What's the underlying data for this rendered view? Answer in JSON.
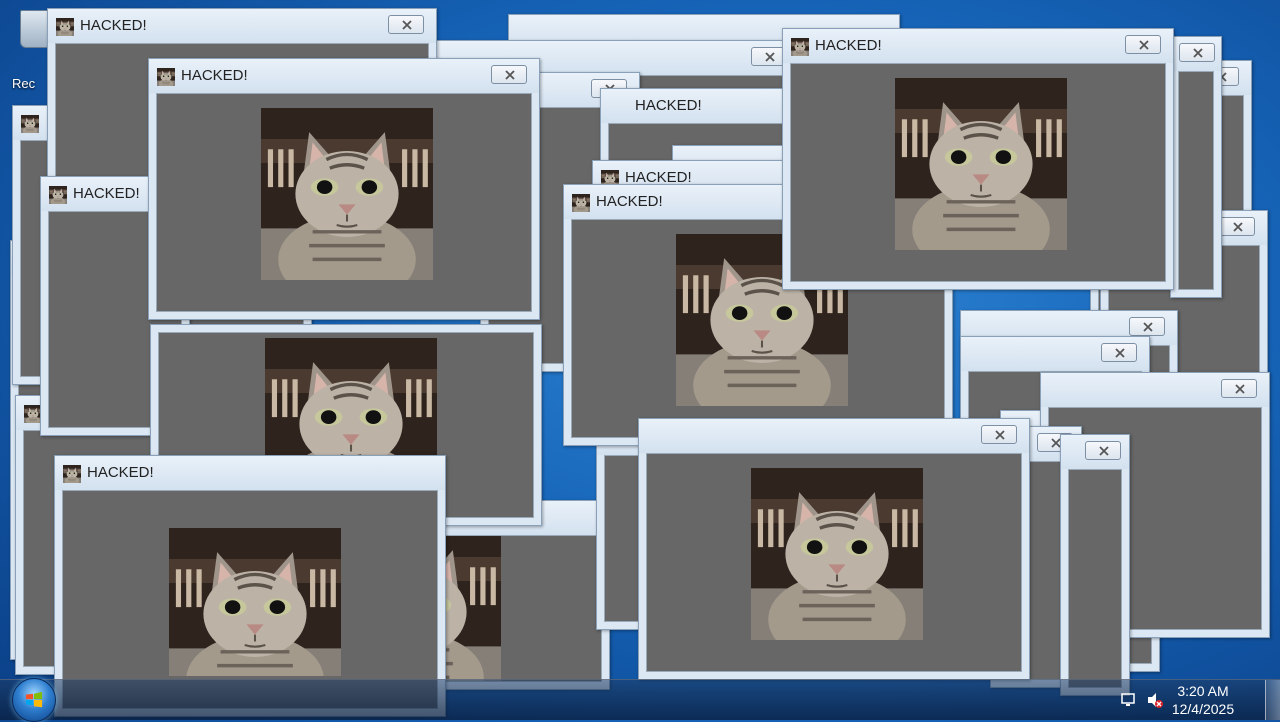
{
  "desktop": {
    "recycle_bin_label": "Rec",
    "icon": "recycle-bin-icon"
  },
  "popup": {
    "title": "HACKED!",
    "title_icon": "cat-thumbnail-icon",
    "close_icon": "close-icon",
    "image": "cat-photo"
  },
  "taskbar": {
    "start_icon": "windows-start-orb-icon",
    "tray_icons": [
      "network-icon",
      "volume-muted-icon"
    ],
    "time": "3:20 AM",
    "date": "12/4/2025"
  }
}
